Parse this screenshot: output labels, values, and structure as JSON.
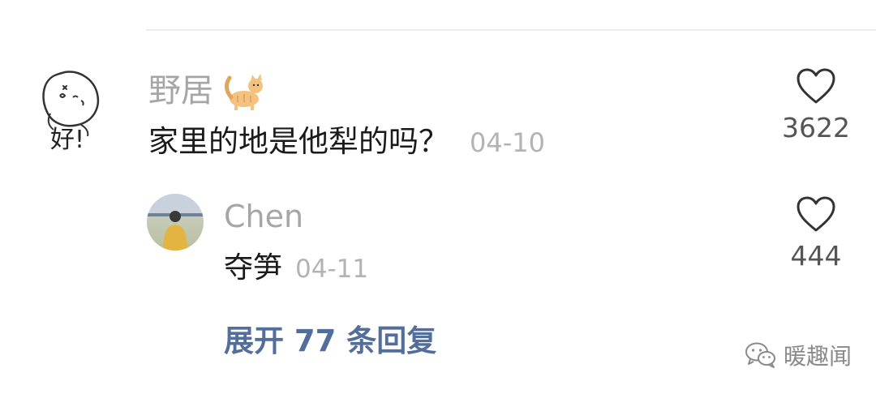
{
  "comment": {
    "avatar_icon": "hand-drawn-face-icon",
    "avatar_text": "好!",
    "username": "野居",
    "username_emoji": "cat-emoji",
    "text": "家里的地是他犁的吗？",
    "date": "04-10",
    "likes": "3622"
  },
  "reply": {
    "username": "Chen",
    "text": "夺笋",
    "date": "04-11",
    "likes": "444"
  },
  "expand": {
    "label": "展开 77 条回复"
  },
  "watermark": {
    "icon": "wechat-icon",
    "text": "暖趣闻"
  },
  "colors": {
    "link": "#536e9a",
    "muted": "#a6a6a6",
    "text": "#1a1a1a"
  }
}
